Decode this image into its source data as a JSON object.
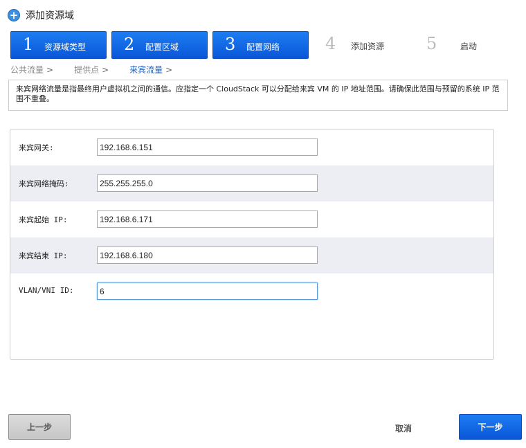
{
  "title": "添加资源域",
  "steps": [
    {
      "num": "1",
      "label": "资源域类型",
      "active": true
    },
    {
      "num": "2",
      "label": "配置区域",
      "active": true
    },
    {
      "num": "3",
      "label": "配置网络",
      "active": true
    },
    {
      "num": "4",
      "label": "添加资源",
      "active": false
    },
    {
      "num": "5",
      "label": "启动",
      "active": false
    }
  ],
  "breadcrumbs": [
    {
      "label": "公共流量",
      "arrow": ">"
    },
    {
      "label": "提供点",
      "arrow": ">"
    },
    {
      "label": "来宾流量",
      "arrow": ">"
    }
  ],
  "description": "来宾网络流量是指最终用户虚拟机之间的通信。应指定一个 CloudStack 可以分配给来宾 VM 的 IP 地址范围。请确保此范围与预留的系统 IP 范围不重叠。",
  "form": [
    {
      "label": "来宾网关:",
      "value": "192.168.6.151"
    },
    {
      "label": "来宾网络掩码:",
      "value": "255.255.255.0"
    },
    {
      "label": "来宾起始 IP:",
      "value": "192.168.6.171"
    },
    {
      "label": "来宾结束 IP:",
      "value": "192.168.6.180"
    },
    {
      "label": "VLAN/VNI ID:",
      "value": "6"
    }
  ],
  "buttons": {
    "prev": "上一步",
    "cancel": "取消",
    "next": "下一步"
  },
  "icons": {
    "title": "plus-circle-icon"
  },
  "colors": {
    "accent": "#0a56d8",
    "row_alt": "#eceef3"
  }
}
